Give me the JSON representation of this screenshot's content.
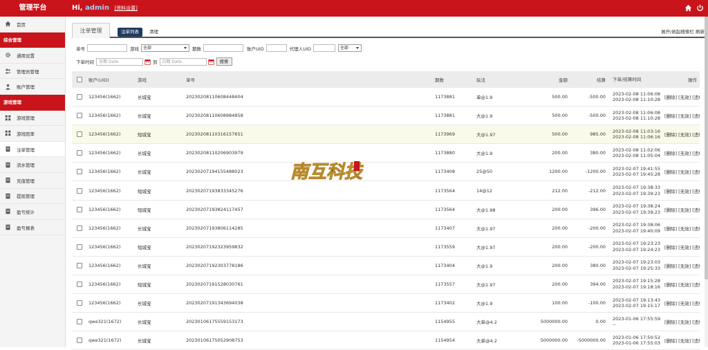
{
  "header": {
    "brand": "管理平台",
    "greet_prefix": "Hi, ",
    "user": "admin",
    "settings_link": "[资料设置]"
  },
  "sidebar": {
    "home": "首页",
    "section1": "综合管理",
    "general": "通用设置",
    "admins": "管理员管理",
    "accounts": "账户管理",
    "section2": "游戏管理",
    "items": [
      "游戏管理",
      "游戏赔率",
      "注单管理",
      "流水管理",
      "充值管理",
      "提现管理",
      "盈亏统计",
      "盈亏报表"
    ]
  },
  "tabs": {
    "outer": "注单管理",
    "active": "注单列表",
    "clear": "清理",
    "right": "展开/收起搜索栏  刷新"
  },
  "filters": {
    "order_no": "单号",
    "game": "游戏",
    "game_value": "全部",
    "period": "期数",
    "account_uid": "账户UID",
    "agent_uid": "代理人UID",
    "agent_value": "全部",
    "time": "下单时间",
    "date_placeholder": "日期 Date",
    "to": "到",
    "search": "搜索"
  },
  "table": {
    "headers": [
      "账户(UID)",
      "游戏",
      "单号",
      "期数",
      "玩法",
      "金额",
      "结算",
      "下单/结算时间",
      "操作"
    ],
    "rows": [
      {
        "acc": "123456(1662)",
        "game": "长城宝",
        "no": "20230208110608448404",
        "period": "1173881",
        "play": "单@1.9",
        "amount": "500.00",
        "settle": "-500.00",
        "t1": "2023-02-08 11:06:08",
        "t2": "2023-02-08 11:10:28",
        "ops": "[删除] [无效] [违规]"
      },
      {
        "acc": "123456(1662)",
        "game": "长城宝",
        "no": "20230208110608984858",
        "period": "1173881",
        "play": "大@1.9",
        "amount": "500.00",
        "settle": "-500.00",
        "t1": "2023-02-08 11:06:08",
        "t2": "2023-02-08 11:10:28",
        "ops": "[删除] [无效] [违规]"
      },
      {
        "acc": "123456(1662)",
        "game": "短城宝",
        "no": "20230208110316157651",
        "period": "1173969",
        "play": "大@1.97",
        "amount": "500.00",
        "settle": "985.00",
        "t1": "2023-02-08 11:03:16",
        "t2": "2023-02-08 11:06:16",
        "ops": "[删除] [无效] [违规]"
      },
      {
        "acc": "123456(1662)",
        "game": "长城宝",
        "no": "20230208110206903979",
        "period": "1173880",
        "play": "大@1.9",
        "amount": "200.00",
        "settle": "380.00",
        "t1": "2023-02-08 11:02:06",
        "t2": "2023-02-08 11:05:04",
        "ops": "[删除] [无效] [违规]"
      },
      {
        "acc": "123456(1662)",
        "game": "长城宝",
        "no": "20230207194155488023",
        "period": "1173408",
        "play": "25@50",
        "amount": "1200.00",
        "settle": "-1200.00",
        "t1": "2023-02-07 19:41:55",
        "t2": "2023-02-07 19:45:28",
        "ops": "[删除] [无效] [违规]"
      },
      {
        "acc": "123456(1662)",
        "game": "短城宝",
        "no": "20230207193833345276",
        "period": "1173564",
        "play": "14@12",
        "amount": "212.00",
        "settle": "-212.00",
        "t1": "2023-02-07 19:38:33",
        "t2": "2023-02-07 19:39:23",
        "ops": "[删除] [无效] [违规]"
      },
      {
        "acc": "123456(1662)",
        "game": "短城宝",
        "no": "20230207193824117457",
        "period": "1173564",
        "play": "大@1.98",
        "amount": "200.00",
        "settle": "396.00",
        "t1": "2023-02-07 19:38:24",
        "t2": "2023-02-07 19:39:23",
        "ops": "[删除] [无效] [违规]"
      },
      {
        "acc": "123456(1662)",
        "game": "长城宝",
        "no": "20230207193806114285",
        "period": "1173407",
        "play": "大@1.97",
        "amount": "200.00",
        "settle": "-200.00",
        "t1": "2023-02-07 19:38:06",
        "t2": "2023-02-07 19:40:09",
        "ops": "[删除] [无效] [违规]"
      },
      {
        "acc": "123456(1662)",
        "game": "短城宝",
        "no": "20230207192323959832",
        "period": "1173559",
        "play": "大@1.97",
        "amount": "200.00",
        "settle": "-200.00",
        "t1": "2023-02-07 19:23:23",
        "t2": "2023-02-07 19:24:23",
        "ops": "[删除] [无效] [违规]"
      },
      {
        "acc": "123456(1662)",
        "game": "长城宝",
        "no": "20230207192303778186",
        "period": "1173404",
        "play": "大@1.9",
        "amount": "200.00",
        "settle": "380.00",
        "t1": "2023-02-07 19:23:03",
        "t2": "2023-02-07 19:25:33",
        "ops": "[删除] [无效] [违规]"
      },
      {
        "acc": "123456(1662)",
        "game": "短城宝",
        "no": "20230207191528030761",
        "period": "1173557",
        "play": "大@1.97",
        "amount": "200.00",
        "settle": "394.00",
        "t1": "2023-02-07 19:15:28",
        "t2": "2023-02-07 19:18:16",
        "ops": "[删除] [无效] [违规]"
      },
      {
        "acc": "123456(1662)",
        "game": "长城宝",
        "no": "20230207191343694038",
        "period": "1173402",
        "play": "大@1.9",
        "amount": "100.00",
        "settle": "-100.00",
        "t1": "2023-02-07 19:13:43",
        "t2": "2023-02-07 19:15:17",
        "ops": "[删除] [无效] [违规]"
      },
      {
        "acc": "qwe321(1672)",
        "game": "长城宝",
        "no": "20230106175559153173",
        "period": "1154955",
        "play": "大单@4.2",
        "amount": "5000000.00",
        "settle": "0.00",
        "t1": "2023-01-06 17:55:59",
        "t2": "--",
        "ops": "[删除] [无效] [违规]"
      },
      {
        "acc": "qwe321(1672)",
        "game": "长城宝",
        "no": "20230106175052908753",
        "period": "1154954",
        "play": "大单@4.2",
        "amount": "5000000.00",
        "settle": "-5000000.00",
        "t1": "2023-01-06 17:50:52",
        "t2": "2023-01-06 17:55:03",
        "ops": "[删除] [无效] [违规]"
      }
    ]
  },
  "watermark": "南互科技",
  "colors": {
    "brand_red": "#c9141b",
    "active_tab": "#1f3a5f",
    "highlight_row": "#fafaea"
  },
  "icons": {
    "home": "home-icon",
    "power": "power-icon"
  }
}
